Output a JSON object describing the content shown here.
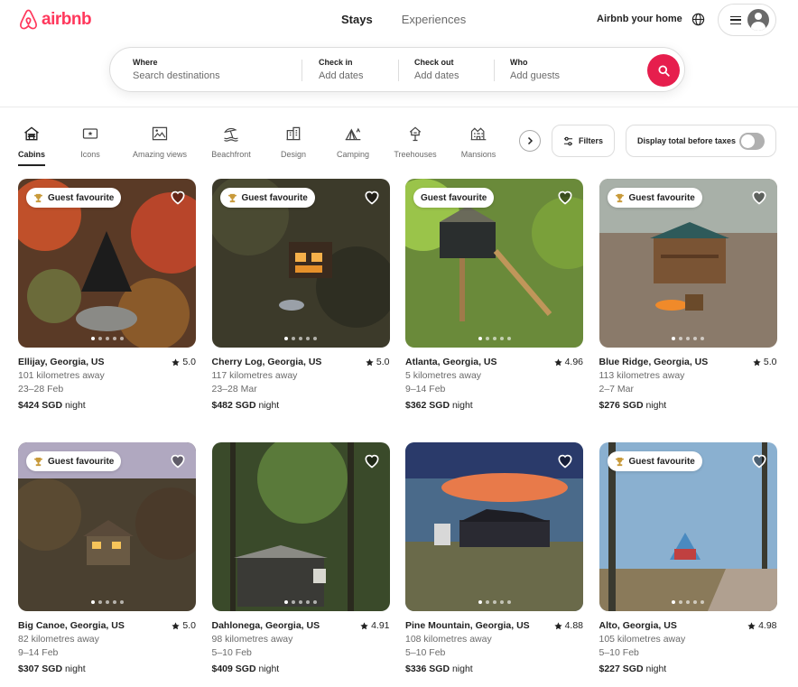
{
  "brand": {
    "name": "airbnb",
    "color": "#ff385c"
  },
  "nav": {
    "stays": "Stays",
    "experiences": "Experiences"
  },
  "header": {
    "host_link": "Airbnb your home"
  },
  "search": {
    "where_label": "Where",
    "where_placeholder": "Search destinations",
    "checkin_label": "Check in",
    "checkin_value": "Add dates",
    "checkout_label": "Check out",
    "checkout_value": "Add dates",
    "who_label": "Who",
    "who_value": "Add guests"
  },
  "categories": [
    {
      "label": "Cabins",
      "icon": "cabin-icon",
      "active": true
    },
    {
      "label": "Icons",
      "icon": "ticket-icon"
    },
    {
      "label": "Amazing views",
      "icon": "picture-icon"
    },
    {
      "label": "Beachfront",
      "icon": "beach-icon"
    },
    {
      "label": "Design",
      "icon": "building-icon"
    },
    {
      "label": "Camping",
      "icon": "tent-icon"
    },
    {
      "label": "Treehouses",
      "icon": "treehouse-icon"
    },
    {
      "label": "Mansions",
      "icon": "mansion-icon"
    }
  ],
  "filters_label": "Filters",
  "taxes_label": "Display total before taxes",
  "listings": [
    {
      "location": "Ellijay, Georgia, US",
      "rating": "5.0",
      "distance": "101 kilometres away",
      "dates": "23–28 Feb",
      "price": "$424 SGD",
      "price_suffix": "night",
      "badge": "Guest favourite",
      "trophy": true
    },
    {
      "location": "Cherry Log, Georgia, US",
      "rating": "5.0",
      "distance": "117 kilometres away",
      "dates": "23–28 Mar",
      "price": "$482 SGD",
      "price_suffix": "night",
      "badge": "Guest favourite",
      "trophy": true
    },
    {
      "location": "Atlanta, Georgia, US",
      "rating": "4.96",
      "distance": "5 kilometres away",
      "dates": "9–14 Feb",
      "price": "$362 SGD",
      "price_suffix": "night",
      "badge": "Guest favourite",
      "trophy": false
    },
    {
      "location": "Blue Ridge, Georgia, US",
      "rating": "5.0",
      "distance": "113 kilometres away",
      "dates": "2–7 Mar",
      "price": "$276 SGD",
      "price_suffix": "night",
      "badge": "Guest favourite",
      "trophy": true
    },
    {
      "location": "Big Canoe, Georgia, US",
      "rating": "5.0",
      "distance": "82 kilometres away",
      "dates": "9–14 Feb",
      "price": "$307 SGD",
      "price_suffix": "night",
      "badge": "Guest favourite",
      "trophy": true
    },
    {
      "location": "Dahlonega, Georgia, US",
      "rating": "4.91",
      "distance": "98 kilometres away",
      "dates": "5–10 Feb",
      "price": "$409 SGD",
      "price_suffix": "night",
      "badge": "",
      "trophy": false
    },
    {
      "location": "Pine Mountain, Georgia, US",
      "rating": "4.88",
      "distance": "108 kilometres away",
      "dates": "5–10 Feb",
      "price": "$336 SGD",
      "price_suffix": "night",
      "badge": "",
      "trophy": false
    },
    {
      "location": "Alto, Georgia, US",
      "rating": "4.98",
      "distance": "105 kilometres away",
      "dates": "5–10 Feb",
      "price": "$227 SGD",
      "price_suffix": "night",
      "badge": "Guest favourite",
      "trophy": true
    }
  ],
  "colors": {
    "search_button": "#e61e4d",
    "text_secondary": "#6a6a6a"
  }
}
